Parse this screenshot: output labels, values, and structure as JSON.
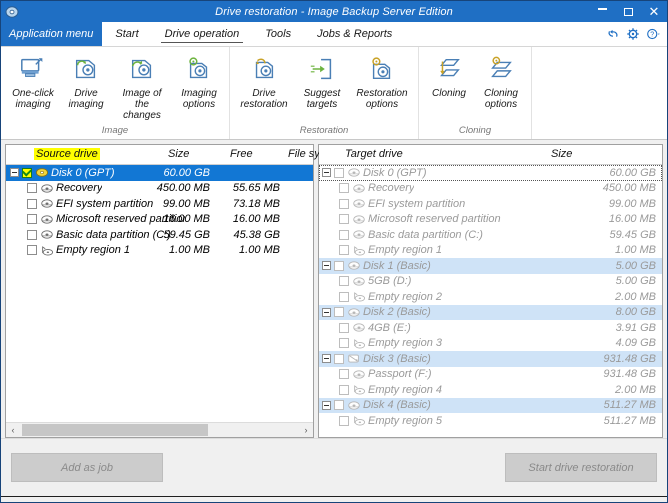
{
  "window": {
    "title": "Drive restoration - Image Backup Server Edition",
    "icon": "disk-icon",
    "minimize_label": "–",
    "maximize_label": "□",
    "close_label": "✕"
  },
  "tabs": {
    "app_menu": "Application menu",
    "items": [
      {
        "label": "Start",
        "active": false
      },
      {
        "label": "Drive operation",
        "active": true
      },
      {
        "label": "Tools",
        "active": false
      },
      {
        "label": "Jobs & Reports",
        "active": false
      }
    ],
    "quick_tools": [
      "undo-icon",
      "settings-gear-icon",
      "help-icon"
    ]
  },
  "ribbon": {
    "groups": [
      {
        "name": "Image",
        "commands": [
          {
            "label": "One-click imaging",
            "icon": "one-click-imaging-icon"
          },
          {
            "label": "Drive imaging",
            "icon": "drive-imaging-icon"
          },
          {
            "label": "Image of the changes",
            "icon": "image-of-changes-icon"
          },
          {
            "label": "Imaging options",
            "icon": "imaging-options-icon"
          }
        ]
      },
      {
        "name": "Restoration",
        "commands": [
          {
            "label": "Drive restoration",
            "icon": "drive-restoration-icon"
          },
          {
            "label": "Suggest targets",
            "icon": "suggest-targets-icon"
          },
          {
            "label": "Restoration options",
            "icon": "restoration-options-icon"
          }
        ]
      },
      {
        "name": "Cloning",
        "commands": [
          {
            "label": "Cloning",
            "icon": "cloning-icon"
          },
          {
            "label": "Cloning options",
            "icon": "cloning-options-icon"
          }
        ]
      }
    ]
  },
  "source_panel": {
    "columns": [
      "Source drive",
      "Size",
      "Free",
      "File sy"
    ],
    "highlight_color": "#ffff00",
    "rows": [
      {
        "name": "Disk 0 (GPT)",
        "size": "60.00 GB",
        "free": "",
        "type": "disk",
        "level": 0,
        "checked": true,
        "expanded": true,
        "selected": true,
        "icon": "disk-icon-yellow"
      },
      {
        "name": "Recovery",
        "size": "450.00 MB",
        "free": "55.65 MB",
        "type": "partition",
        "level": 1,
        "checked": false,
        "icon": "partition-icon"
      },
      {
        "name": "EFI system partition",
        "size": "99.00 MB",
        "free": "73.18 MB",
        "type": "partition",
        "level": 1,
        "checked": false,
        "icon": "partition-icon"
      },
      {
        "name": "Microsoft reserved partition",
        "size": "16.00 MB",
        "free": "16.00 MB",
        "type": "partition",
        "level": 1,
        "checked": false,
        "icon": "partition-icon"
      },
      {
        "name": "Basic data partition (C:)",
        "size": "59.45 GB",
        "free": "45.38 GB",
        "type": "partition",
        "level": 1,
        "checked": false,
        "icon": "partition-icon"
      },
      {
        "name": "Empty region 1",
        "size": "1.00 MB",
        "free": "1.00 MB",
        "type": "empty",
        "level": 1,
        "checked": false,
        "icon": "empty-region-icon"
      }
    ],
    "scrollbar": {
      "left_arrow": "‹",
      "right_arrow": "›"
    }
  },
  "target_panel": {
    "columns": [
      "Target drive",
      "Size"
    ],
    "rows": [
      {
        "name": "Disk 0 (GPT)",
        "size": "60.00 GB",
        "type": "disk",
        "level": 0,
        "expanded": true,
        "checkbox": true,
        "focused": true,
        "icon": "disk-icon"
      },
      {
        "name": "Recovery",
        "size": "450.00 MB",
        "type": "partition",
        "level": 1,
        "checkbox": true,
        "icon": "partition-icon"
      },
      {
        "name": "EFI system partition",
        "size": "99.00 MB",
        "type": "partition",
        "level": 1,
        "checkbox": true,
        "icon": "partition-icon"
      },
      {
        "name": "Microsoft reserved partition",
        "size": "16.00 MB",
        "type": "partition",
        "level": 1,
        "checkbox": true,
        "icon": "partition-icon"
      },
      {
        "name": "Basic data partition (C:)",
        "size": "59.45 GB",
        "type": "partition",
        "level": 1,
        "checkbox": true,
        "icon": "partition-icon"
      },
      {
        "name": "Empty region 1",
        "size": "1.00 MB",
        "type": "empty",
        "level": 1,
        "checkbox": true,
        "icon": "empty-region-icon"
      },
      {
        "name": "Disk 1 (Basic)",
        "size": "5.00 GB",
        "type": "disk",
        "level": 0,
        "expanded": true,
        "checkbox": true,
        "highlight": true,
        "icon": "disk-icon"
      },
      {
        "name": "5GB (D:)",
        "size": "5.00 GB",
        "type": "partition",
        "level": 1,
        "checkbox": true,
        "icon": "partition-icon"
      },
      {
        "name": "Empty region 2",
        "size": "2.00 MB",
        "type": "empty",
        "level": 1,
        "checkbox": true,
        "icon": "empty-region-icon"
      },
      {
        "name": "Disk 2 (Basic)",
        "size": "8.00 GB",
        "type": "disk",
        "level": 0,
        "expanded": true,
        "checkbox": true,
        "highlight": true,
        "icon": "disk-icon"
      },
      {
        "name": "4GB (E:)",
        "size": "3.91 GB",
        "type": "partition",
        "level": 1,
        "checkbox": true,
        "icon": "partition-icon"
      },
      {
        "name": "Empty region 3",
        "size": "4.09 GB",
        "type": "empty",
        "level": 1,
        "checkbox": true,
        "icon": "empty-region-icon"
      },
      {
        "name": "Disk 3 (Basic)",
        "size": "931.48 GB",
        "type": "disk",
        "level": 0,
        "expanded": true,
        "checkbox": true,
        "highlight": true,
        "icon": "external-disk-icon"
      },
      {
        "name": "Passport (F:)",
        "size": "931.48 GB",
        "type": "partition",
        "level": 1,
        "checkbox": true,
        "icon": "partition-icon"
      },
      {
        "name": "Empty region 4",
        "size": "2.00 MB",
        "type": "empty",
        "level": 1,
        "checkbox": true,
        "icon": "empty-region-icon"
      },
      {
        "name": "Disk 4 (Basic)",
        "size": "511.27 MB",
        "type": "disk",
        "level": 0,
        "expanded": true,
        "checkbox": true,
        "highlight": true,
        "icon": "disk-icon"
      },
      {
        "name": "Empty region 5",
        "size": "511.27 MB",
        "type": "empty",
        "level": 1,
        "checkbox": true,
        "icon": "empty-region-icon"
      }
    ]
  },
  "footer": {
    "add_as_job": "Add as job",
    "start_restoration": "Start drive restoration"
  },
  "colors": {
    "titlebar": "#1f6fc4",
    "selection": "#1277d4",
    "disk_row_highlight": "#cfe3f7",
    "highlight_yellow": "#ffff00",
    "disabled_text": "#9a9a9a"
  }
}
